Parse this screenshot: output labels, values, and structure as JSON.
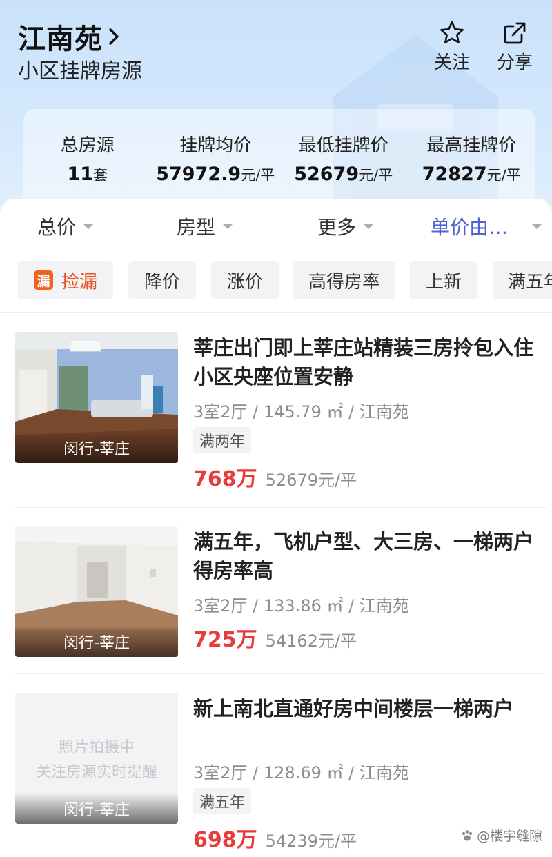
{
  "header": {
    "title": "江南苑",
    "subtitle": "小区挂牌房源",
    "actions": [
      {
        "label": "关注",
        "icon": "star-icon"
      },
      {
        "label": "分享",
        "icon": "share-icon"
      }
    ]
  },
  "stats": [
    {
      "label": "总房源",
      "value": "11",
      "unit": "套"
    },
    {
      "label": "挂牌均价",
      "value": "57972.9",
      "unit": "元/平"
    },
    {
      "label": "最低挂牌价",
      "value": "52679",
      "unit": "元/平"
    },
    {
      "label": "最高挂牌价",
      "value": "72827",
      "unit": "元/平"
    }
  ],
  "filters": [
    {
      "label": "总价"
    },
    {
      "label": "房型"
    },
    {
      "label": "更多"
    },
    {
      "label": "单价由…"
    }
  ],
  "tags": [
    {
      "label": "捡漏",
      "badge": "漏"
    },
    {
      "label": "降价"
    },
    {
      "label": "涨价"
    },
    {
      "label": "高得房率"
    },
    {
      "label": "上新"
    },
    {
      "label": "满五年"
    }
  ],
  "listings": [
    {
      "title": "莘庄出门即上莘庄站精装三房拎包入住小区央座位置安静",
      "spec": "3室2厅 / 145.79 ㎡ / 江南苑",
      "tag": "满两年",
      "total_price": "768万",
      "unit_price": "52679元/平",
      "location": "闵行-莘庄"
    },
    {
      "title": "满五年，飞机户型、大三房、一梯两户得房率高",
      "spec": "3室2厅 / 133.86 ㎡ / 江南苑",
      "tag": "",
      "total_price": "725万",
      "unit_price": "54162元/平",
      "location": "闵行-莘庄"
    },
    {
      "title": "新上南北直通好房中间楼层一梯两户",
      "spec": "3室2厅 / 128.69 ㎡ / 江南苑",
      "tag": "满五年",
      "total_price": "698万",
      "unit_price": "54239元/平",
      "location": "闵行-莘庄",
      "placeholder_line1": "照片拍摄中",
      "placeholder_line2": "关注房源实时提醒"
    }
  ],
  "watermark": "@楼宇缝隙",
  "colors": {
    "accent": "#4f63d2",
    "price": "#e83b3b",
    "badge": "#f0621f",
    "hero_bg": "#cfe5fb"
  }
}
